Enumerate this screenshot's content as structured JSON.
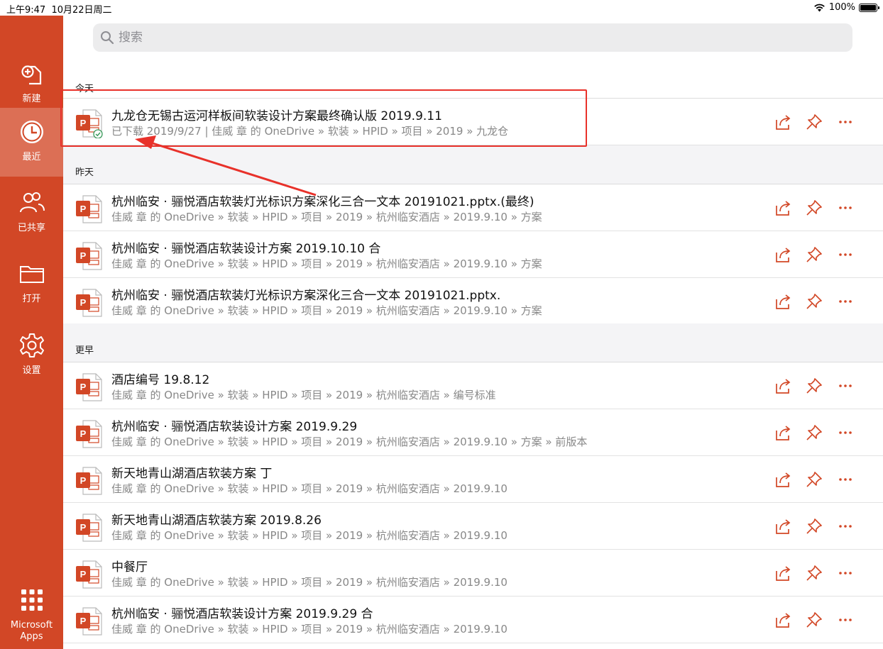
{
  "status_bar": {
    "time": "上午9:47",
    "date": "10月22日周二",
    "battery": "100%"
  },
  "sidebar": {
    "items": [
      {
        "label": "新建",
        "icon": "new-document-icon"
      },
      {
        "label": "最近",
        "icon": "clock-icon",
        "active": true
      },
      {
        "label": "已共享",
        "icon": "people-icon"
      },
      {
        "label": "打开",
        "icon": "folder-icon"
      },
      {
        "label": "设置",
        "icon": "gear-icon"
      }
    ],
    "apps_label_line1": "Microsoft",
    "apps_label_line2": "Apps"
  },
  "search": {
    "placeholder": "搜索"
  },
  "sections": {
    "today": "今天",
    "yesterday": "昨天",
    "earlier": "更早"
  },
  "files": {
    "today": [
      {
        "title": "九龙仓无锡古运河样板间软装设计方案最终确认版  2019.9.11",
        "sub": "已下载 2019/9/27 | 佳威 章 的 OneDrive » 软装 » HPID » 项目 » 2019 » 九龙仓"
      }
    ],
    "yesterday": [
      {
        "title": "杭州临安 · 骊悦酒店软装灯光标识方案深化三合一文本 20191021.pptx.(最终)",
        "sub": "佳威 章 的 OneDrive » 软装 » HPID » 项目 » 2019 » 杭州临安酒店 » 2019.9.10 » 方案"
      },
      {
        "title": "杭州临安 · 骊悦酒店软装设计方案 2019.10.10 合",
        "sub": "佳威 章 的 OneDrive » 软装 » HPID » 项目 » 2019 » 杭州临安酒店 » 2019.9.10 » 方案"
      },
      {
        "title": "杭州临安 · 骊悦酒店软装灯光标识方案深化三合一文本 20191021.pptx.",
        "sub": "佳威 章 的 OneDrive » 软装 » HPID » 项目 » 2019 » 杭州临安酒店 » 2019.9.10 » 方案"
      }
    ],
    "earlier": [
      {
        "title": "酒店编号 19.8.12",
        "sub": "佳威 章 的 OneDrive » 软装 » HPID » 项目 » 2019 » 杭州临安酒店 » 编号标准"
      },
      {
        "title": "杭州临安 · 骊悦酒店软装设计方案 2019.9.29",
        "sub": "佳威 章 的 OneDrive » 软装 » HPID » 项目 » 2019 » 杭州临安酒店 » 2019.9.10 » 方案 » 前版本"
      },
      {
        "title": "新天地青山湖酒店软装方案 丁",
        "sub": "佳威 章 的 OneDrive » 软装 » HPID » 项目 » 2019 » 杭州临安酒店 » 2019.9.10"
      },
      {
        "title": "新天地青山湖酒店软装方案  2019.8.26",
        "sub": "佳威 章 的 OneDrive » 软装 » HPID » 项目 » 2019 » 杭州临安酒店 » 2019.9.10"
      },
      {
        "title": "中餐厅",
        "sub": "佳威 章 的 OneDrive » 软装 » HPID » 项目 » 2019 » 杭州临安酒店 » 2019.9.10"
      },
      {
        "title": "杭州临安 · 骊悦酒店软装设计方案 2019.9.29 合",
        "sub": "佳威 章 的 OneDrive » 软装 » HPID » 项目 » 2019 » 杭州临安酒店 » 2019.9.10"
      }
    ]
  },
  "colors": {
    "accent": "#d24726",
    "annotation": "#e8312a"
  }
}
